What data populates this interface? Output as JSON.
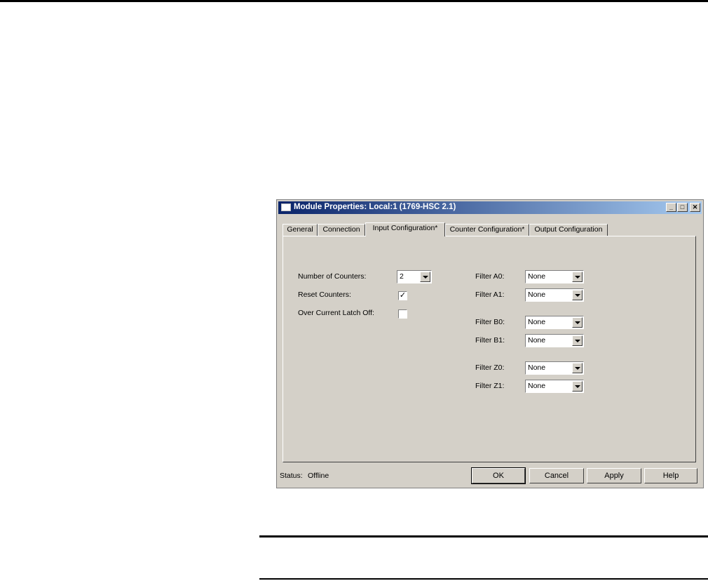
{
  "window": {
    "title": "Module Properties: Local:1 (1769-HSC 2.1)",
    "min_glyph": "_",
    "max_glyph": "□",
    "close_glyph": "✕"
  },
  "tabs": [
    {
      "label": "General"
    },
    {
      "label": "Connection"
    },
    {
      "label": "Input Configuration*",
      "active": true
    },
    {
      "label": "Counter Configuration*"
    },
    {
      "label": "Output Configuration"
    }
  ],
  "input_config": {
    "number_of_counters": {
      "label": "Number of Counters:",
      "value": "2"
    },
    "reset_counters": {
      "label": "Reset Counters:",
      "checked": true,
      "mark": "✓"
    },
    "over_current_latch_off": {
      "label": "Over Current Latch Off:",
      "checked": false,
      "mark": ""
    },
    "filters": [
      {
        "label": "Filter A0:",
        "value": "None"
      },
      {
        "label": "Filter A1:",
        "value": "None"
      },
      {
        "label": "Filter B0:",
        "value": "None"
      },
      {
        "label": "Filter B1:",
        "value": "None"
      },
      {
        "label": "Filter Z0:",
        "value": "None"
      },
      {
        "label": "Filter Z1:",
        "value": "None"
      }
    ]
  },
  "status": {
    "label": "Status:",
    "value": "Offline"
  },
  "buttons": {
    "ok": "OK",
    "cancel": "Cancel",
    "apply": "Apply",
    "help": "Help"
  }
}
